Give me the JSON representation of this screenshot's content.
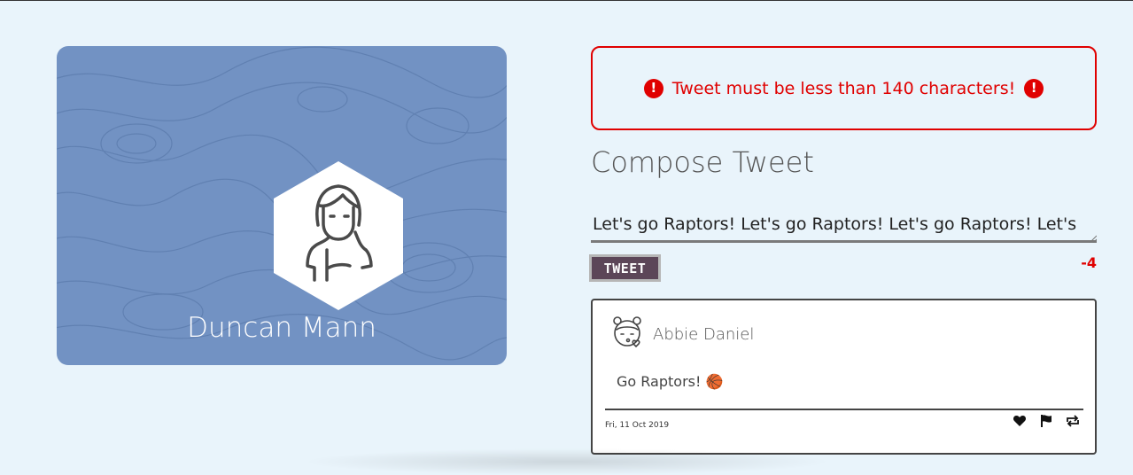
{
  "profile": {
    "name": "Duncan Mann",
    "avatar_icon": "user-avatar-icon",
    "card_color": "#7292c3"
  },
  "error": {
    "message": "Tweet must be less than 140 characters!",
    "icon": "alert-circle-icon",
    "icon_glyph": "!",
    "color": "#e00000"
  },
  "compose": {
    "title": "Compose Tweet",
    "input_value": "Let's go Raptors! Let's go Raptors! Let's go Raptors! Let's",
    "button_label": "TWEET",
    "char_counter": "-4"
  },
  "tweets": [
    {
      "author": "Abbie Daniel",
      "text": "Go Raptors! 🏀",
      "date": "Fri, 11 Oct 2019",
      "actions": [
        "heart-icon",
        "flag-icon",
        "retweet-icon"
      ]
    }
  ]
}
